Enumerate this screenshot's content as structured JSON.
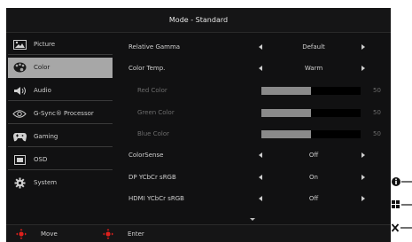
{
  "title": "Mode - Standard",
  "sidebar": {
    "items": [
      {
        "label": "Picture",
        "icon": "picture-icon"
      },
      {
        "label": "Color",
        "icon": "palette-icon",
        "active": true
      },
      {
        "label": "Audio",
        "icon": "speaker-icon"
      },
      {
        "label": "G-Sync® Processor",
        "icon": "gsync-icon"
      },
      {
        "label": "Gaming",
        "icon": "gamepad-icon"
      },
      {
        "label": "OSD",
        "icon": "osd-icon"
      },
      {
        "label": "System",
        "icon": "gear-icon"
      }
    ]
  },
  "settings": {
    "relative_gamma": {
      "label": "Relative Gamma",
      "value": "Default"
    },
    "color_temp": {
      "label": "Color Temp.",
      "value": "Warm"
    },
    "red": {
      "label": "Red Color",
      "value": "50",
      "level": 0.5
    },
    "green": {
      "label": "Green Color",
      "value": "50",
      "level": 0.5
    },
    "blue": {
      "label": "Blue Color",
      "value": "50",
      "level": 0.5
    },
    "colorsense": {
      "label": "ColorSense",
      "value": "Off"
    },
    "dp_ycbcr": {
      "label": "DP YCbCr sRGB",
      "value": "On"
    },
    "hdmi_ycbcr": {
      "label": "HDMI YCbCr sRGB",
      "value": "Off"
    }
  },
  "footer": {
    "move_label": "Move",
    "enter_label": "Enter"
  },
  "colors": {
    "background": "#111112",
    "active": "#a7a7a7",
    "accent_red": "#e0201c",
    "slider_fill": "#8a8a8a"
  }
}
